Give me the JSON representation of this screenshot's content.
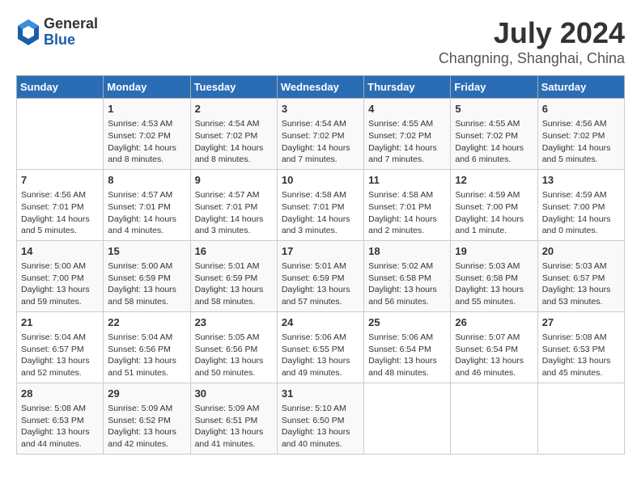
{
  "header": {
    "logo": {
      "general": "General",
      "blue": "Blue"
    },
    "title": "July 2024",
    "subtitle": "Changning, Shanghai, China"
  },
  "days_of_week": [
    "Sunday",
    "Monday",
    "Tuesday",
    "Wednesday",
    "Thursday",
    "Friday",
    "Saturday"
  ],
  "weeks": [
    [
      {
        "day": "",
        "info": ""
      },
      {
        "day": "1",
        "info": "Sunrise: 4:53 AM\nSunset: 7:02 PM\nDaylight: 14 hours\nand 8 minutes."
      },
      {
        "day": "2",
        "info": "Sunrise: 4:54 AM\nSunset: 7:02 PM\nDaylight: 14 hours\nand 8 minutes."
      },
      {
        "day": "3",
        "info": "Sunrise: 4:54 AM\nSunset: 7:02 PM\nDaylight: 14 hours\nand 7 minutes."
      },
      {
        "day": "4",
        "info": "Sunrise: 4:55 AM\nSunset: 7:02 PM\nDaylight: 14 hours\nand 7 minutes."
      },
      {
        "day": "5",
        "info": "Sunrise: 4:55 AM\nSunset: 7:02 PM\nDaylight: 14 hours\nand 6 minutes."
      },
      {
        "day": "6",
        "info": "Sunrise: 4:56 AM\nSunset: 7:02 PM\nDaylight: 14 hours\nand 5 minutes."
      }
    ],
    [
      {
        "day": "7",
        "info": "Sunrise: 4:56 AM\nSunset: 7:01 PM\nDaylight: 14 hours\nand 5 minutes."
      },
      {
        "day": "8",
        "info": "Sunrise: 4:57 AM\nSunset: 7:01 PM\nDaylight: 14 hours\nand 4 minutes."
      },
      {
        "day": "9",
        "info": "Sunrise: 4:57 AM\nSunset: 7:01 PM\nDaylight: 14 hours\nand 3 minutes."
      },
      {
        "day": "10",
        "info": "Sunrise: 4:58 AM\nSunset: 7:01 PM\nDaylight: 14 hours\nand 3 minutes."
      },
      {
        "day": "11",
        "info": "Sunrise: 4:58 AM\nSunset: 7:01 PM\nDaylight: 14 hours\nand 2 minutes."
      },
      {
        "day": "12",
        "info": "Sunrise: 4:59 AM\nSunset: 7:00 PM\nDaylight: 14 hours\nand 1 minute."
      },
      {
        "day": "13",
        "info": "Sunrise: 4:59 AM\nSunset: 7:00 PM\nDaylight: 14 hours\nand 0 minutes."
      }
    ],
    [
      {
        "day": "14",
        "info": "Sunrise: 5:00 AM\nSunset: 7:00 PM\nDaylight: 13 hours\nand 59 minutes."
      },
      {
        "day": "15",
        "info": "Sunrise: 5:00 AM\nSunset: 6:59 PM\nDaylight: 13 hours\nand 58 minutes."
      },
      {
        "day": "16",
        "info": "Sunrise: 5:01 AM\nSunset: 6:59 PM\nDaylight: 13 hours\nand 58 minutes."
      },
      {
        "day": "17",
        "info": "Sunrise: 5:01 AM\nSunset: 6:59 PM\nDaylight: 13 hours\nand 57 minutes."
      },
      {
        "day": "18",
        "info": "Sunrise: 5:02 AM\nSunset: 6:58 PM\nDaylight: 13 hours\nand 56 minutes."
      },
      {
        "day": "19",
        "info": "Sunrise: 5:03 AM\nSunset: 6:58 PM\nDaylight: 13 hours\nand 55 minutes."
      },
      {
        "day": "20",
        "info": "Sunrise: 5:03 AM\nSunset: 6:57 PM\nDaylight: 13 hours\nand 53 minutes."
      }
    ],
    [
      {
        "day": "21",
        "info": "Sunrise: 5:04 AM\nSunset: 6:57 PM\nDaylight: 13 hours\nand 52 minutes."
      },
      {
        "day": "22",
        "info": "Sunrise: 5:04 AM\nSunset: 6:56 PM\nDaylight: 13 hours\nand 51 minutes."
      },
      {
        "day": "23",
        "info": "Sunrise: 5:05 AM\nSunset: 6:56 PM\nDaylight: 13 hours\nand 50 minutes."
      },
      {
        "day": "24",
        "info": "Sunrise: 5:06 AM\nSunset: 6:55 PM\nDaylight: 13 hours\nand 49 minutes."
      },
      {
        "day": "25",
        "info": "Sunrise: 5:06 AM\nSunset: 6:54 PM\nDaylight: 13 hours\nand 48 minutes."
      },
      {
        "day": "26",
        "info": "Sunrise: 5:07 AM\nSunset: 6:54 PM\nDaylight: 13 hours\nand 46 minutes."
      },
      {
        "day": "27",
        "info": "Sunrise: 5:08 AM\nSunset: 6:53 PM\nDaylight: 13 hours\nand 45 minutes."
      }
    ],
    [
      {
        "day": "28",
        "info": "Sunrise: 5:08 AM\nSunset: 6:53 PM\nDaylight: 13 hours\nand 44 minutes."
      },
      {
        "day": "29",
        "info": "Sunrise: 5:09 AM\nSunset: 6:52 PM\nDaylight: 13 hours\nand 42 minutes."
      },
      {
        "day": "30",
        "info": "Sunrise: 5:09 AM\nSunset: 6:51 PM\nDaylight: 13 hours\nand 41 minutes."
      },
      {
        "day": "31",
        "info": "Sunrise: 5:10 AM\nSunset: 6:50 PM\nDaylight: 13 hours\nand 40 minutes."
      },
      {
        "day": "",
        "info": ""
      },
      {
        "day": "",
        "info": ""
      },
      {
        "day": "",
        "info": ""
      }
    ]
  ]
}
